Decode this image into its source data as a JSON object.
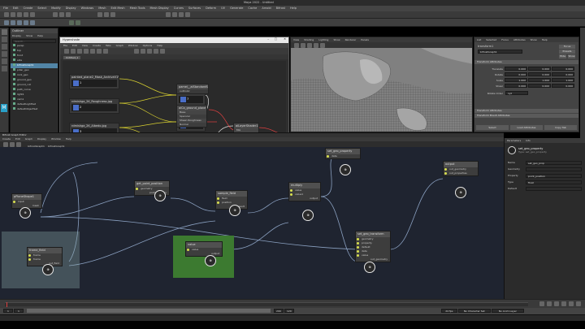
{
  "maya": {
    "title": "Maya 2022 - Untitled",
    "menus": [
      "File",
      "Edit",
      "Create",
      "Select",
      "Modify",
      "Display",
      "Windows",
      "Mesh",
      "Edit Mesh",
      "Mesh Tools",
      "Mesh Display",
      "Curves",
      "Surfaces",
      "Deform",
      "UV",
      "Generate",
      "Cache",
      "Arnold",
      "Bifrost",
      "Help"
    ],
    "outliner": {
      "title": "Outliner",
      "menus": [
        "Display",
        "Show",
        "Help"
      ],
      "search": "Search...",
      "items": [
        "persp",
        "top",
        "front",
        "side",
        "bifrostGraph1",
        "pillar_geo",
        "rock_geo",
        "ground_geo",
        "ground_cut",
        "path_curve",
        "light1",
        "cam1",
        "defaultLightSet",
        "defaultObjectSet"
      ]
    },
    "attribute_editor": {
      "tabs": [
        "List",
        "Selected",
        "Focus",
        "Attributes",
        "Show",
        "Help"
      ],
      "node_label": "bifrostGraph1",
      "transform_label": "transform1",
      "section": "Transform Attributes",
      "rows": [
        {
          "label": "Translate",
          "v": [
            "0.000",
            "0.000",
            "0.000"
          ]
        },
        {
          "label": "Rotate",
          "v": [
            "0.000",
            "0.000",
            "0.000"
          ]
        },
        {
          "label": "Scale",
          "v": [
            "1.000",
            "1.000",
            "1.000"
          ]
        },
        {
          "label": "Shear",
          "v": [
            "0.000",
            "0.000",
            "0.000"
          ]
        }
      ],
      "rotate_order_label": "Rotate Order",
      "rotate_order": "xyz",
      "sub_sections": [
        "Transform Attributes",
        "Transform Brevit Attributes"
      ],
      "buttons": [
        "Select",
        "Load Attributes",
        "Copy Tab"
      ],
      "focus_btn": "Focus",
      "presets_btn": "Presets",
      "show_btn": "Show",
      "hide_btn": "Hide"
    },
    "viewport": {
      "menus": [
        "View",
        "Shading",
        "Lighting",
        "Show",
        "Renderer",
        "Panels"
      ],
      "label": "front"
    }
  },
  "hypershade": {
    "title": "Hypershade",
    "menus": [
      "File",
      "Edit",
      "View",
      "Create",
      "Tabs",
      "Graph",
      "Window",
      "Options",
      "Help"
    ],
    "tab": "Untitled_1",
    "nodes": [
      {
        "title": "painted_plane2_Mask_ArchiveV1V",
        "port": "alphaGain",
        "num": "1"
      },
      {
        "title": "rdmishga_2K_Roughness.jpg",
        "port": "alphaGain",
        "num": "2"
      },
      {
        "title": "rdmishga_2K_Albedo.jpg",
        "port": "alphaGain",
        "num": "3"
      },
      {
        "title": "rdmishga_2K_Normal.jpg",
        "port": "alphaGain",
        "num": "4"
      },
      {
        "title": "painted_plane2_Mask_ArchiveV2V",
        "port": "alphaGain",
        "num": "5"
      },
      {
        "title": "rdmishga_2K_Roughness.jpg",
        "port": "alphaGain",
        "num": "6"
      },
      {
        "title": "aiColorCorrect1",
        "port": "alpha",
        "num": "7"
      },
      {
        "title": "aiColorCorrect2",
        "port": "alpha",
        "num": "8"
      },
      {
        "title": "aiColorCorrect3",
        "port": "alpha",
        "num": "9"
      },
      {
        "title": "aiCa_ground_plane",
        "ports": [
          "Base",
          "Specular",
          "Sheen Roughness",
          "Normal"
        ]
      },
      {
        "title": "aiLayerShader1",
        "ports": [
          "Mix",
          "Input 1",
          "Input 2"
        ]
      },
      {
        "title": "aiMixShader1",
        "port": "Result"
      },
      {
        "title": "pamel__aiStandardSurface1",
        "port": "outColor"
      }
    ]
  },
  "bifrost": {
    "title": "Bifrost Graph Editor",
    "menus": [
      "Create",
      "Edit",
      "Graph",
      "Display",
      "Window",
      "Help"
    ],
    "tabs": [
      "bifrostGraph1"
    ],
    "breadcrumb": [
      "bifrostGraph1",
      "bifrostGraph1"
    ],
    "nodes": [
      {
        "id": "plane",
        "title": "pPlaneShape1",
        "ports": [
          "input"
        ],
        "out": "mesh"
      },
      {
        "id": "frame",
        "title": "frame_field",
        "ports": [
          "frame",
          "frame"
        ],
        "out": "out_field"
      },
      {
        "id": "getpoint",
        "title": "get_point_position",
        "ports": [
          "geometry"
        ],
        "out": "point_position"
      },
      {
        "id": "sample",
        "title": "sample_field",
        "ports": [
          "field",
          "position"
        ],
        "out": "result"
      },
      {
        "id": "multiply",
        "title": "multiply",
        "ports": [
          "value",
          "value1"
        ],
        "out": "output"
      },
      {
        "id": "value",
        "title": "value",
        "ports": [
          ""
        ],
        "out": "output"
      },
      {
        "id": "setgeo",
        "title": "set_geo_transform",
        "ports": [
          "geometry",
          "property",
          "default",
          "data",
          "value"
        ],
        "out": "out_geometry"
      },
      {
        "id": "output",
        "title": "output",
        "ports": [
          "out_geometry",
          "out_properties"
        ]
      },
      {
        "id": "setgeo2",
        "title": "set_geo_property",
        "ports": [
          "data"
        ],
        "out": ""
      },
      {
        "id": "green",
        "title": "value",
        "ports": [
          "value"
        ],
        "out": "output"
      }
    ],
    "properties": {
      "title": "Parameters",
      "tabs": [
        "Parameters",
        "Info"
      ],
      "node": "set_geo_property",
      "subtitle": "Type: set_geo_property",
      "fields": [
        {
          "label": "Name",
          "value": "set_geo_prop"
        },
        {
          "label": "Geometry",
          "value": ""
        },
        {
          "label": "Property",
          "value": "point_position"
        },
        {
          "label": "Type",
          "value": "float"
        },
        {
          "label": "Default",
          "value": ""
        }
      ]
    }
  },
  "timeline": {
    "start": "1",
    "end": "120",
    "current": "1",
    "range_start": "1",
    "range_end": "200",
    "fps": "24 fps",
    "char_set": "No Character Set",
    "anim_layer": "No Anim Layer"
  }
}
